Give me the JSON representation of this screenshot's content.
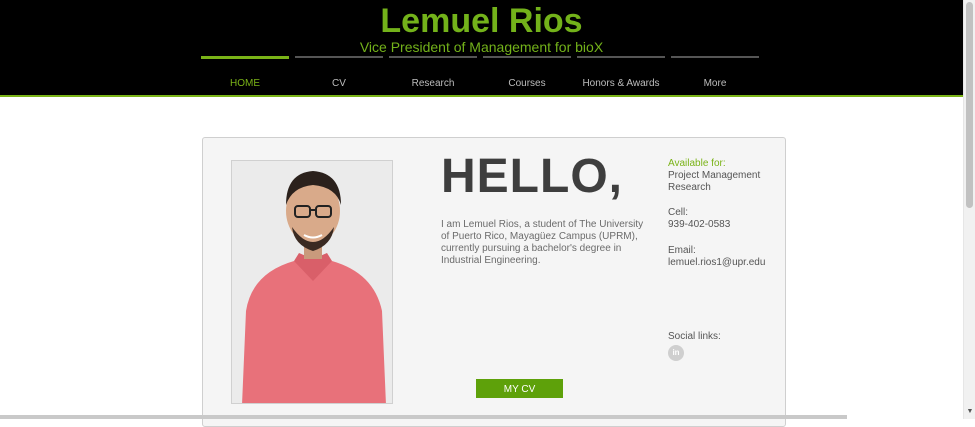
{
  "header": {
    "title": "Lemuel Rios",
    "subtitle": "Vice President of Management for bioX"
  },
  "nav": {
    "items": [
      {
        "label": "HOME",
        "active": true
      },
      {
        "label": "CV"
      },
      {
        "label": "Research"
      },
      {
        "label": "Courses"
      },
      {
        "label": "Honors & Awards"
      },
      {
        "label": "More"
      }
    ]
  },
  "main": {
    "greeting": "HELLO,",
    "intro": "I am Lemuel Rios, a student of The University of Puerto Rico, Mayagüez Campus (UPRM), currently pursuing a bachelor's degree in Industrial Engineering.",
    "cv_button": "MY CV"
  },
  "sidebar": {
    "available_label": "Available for:",
    "available_items": [
      "Project Management",
      "Research"
    ],
    "cell_label": "Cell:",
    "cell_value": "939-402-0583",
    "email_label": "Email:",
    "email_value": "lemuel.rios1@upr.edu",
    "social_label": "Social links:",
    "social_icons": [
      "linkedin-icon"
    ]
  },
  "colors": {
    "accent": "#7ab317",
    "button": "#5ea10a",
    "header_bg": "#000000"
  }
}
